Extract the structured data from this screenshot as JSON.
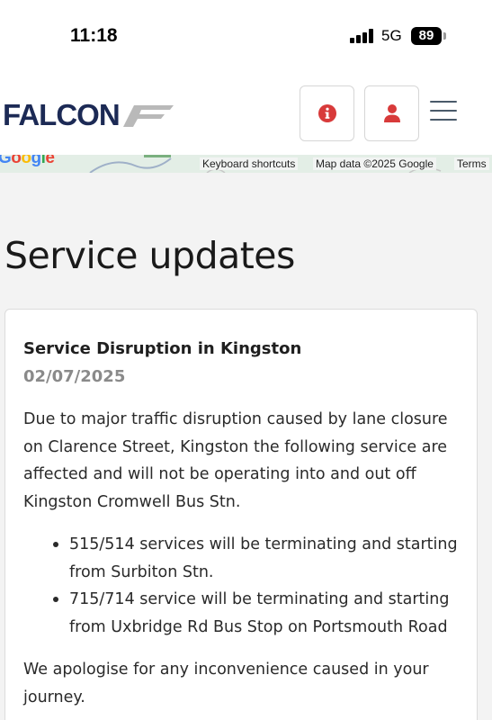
{
  "status": {
    "time": "11:18",
    "network": "5G",
    "battery": "89"
  },
  "header": {
    "logo_text": "FALCON",
    "icons": [
      "info-icon",
      "account-icon",
      "hamburger-menu-icon"
    ],
    "accent_color": "#d83a3a",
    "brand_color": "#1c2a55"
  },
  "map": {
    "logo": "Google",
    "keyboard_shortcuts": "Keyboard shortcuts",
    "map_data": "Map data ©2025 Google",
    "terms": "Terms"
  },
  "page": {
    "title": "Service updates"
  },
  "update": {
    "title": "Service Disruption in Kingston",
    "date": "02/07/2025",
    "intro": "Due to major traffic disruption caused by lane closure on Clarence Street, Kingston the following service are affected and will not be operating into and out off Kingston Cromwell Bus Stn.",
    "bullets": [
      "515/514 services will be terminating and starting from Surbiton Stn.",
      "715/714 service will be terminating and starting from Uxbridge Rd Bus Stop on Portsmouth Road"
    ],
    "closing": "We apologise for any inconvenience caused in your journey."
  }
}
